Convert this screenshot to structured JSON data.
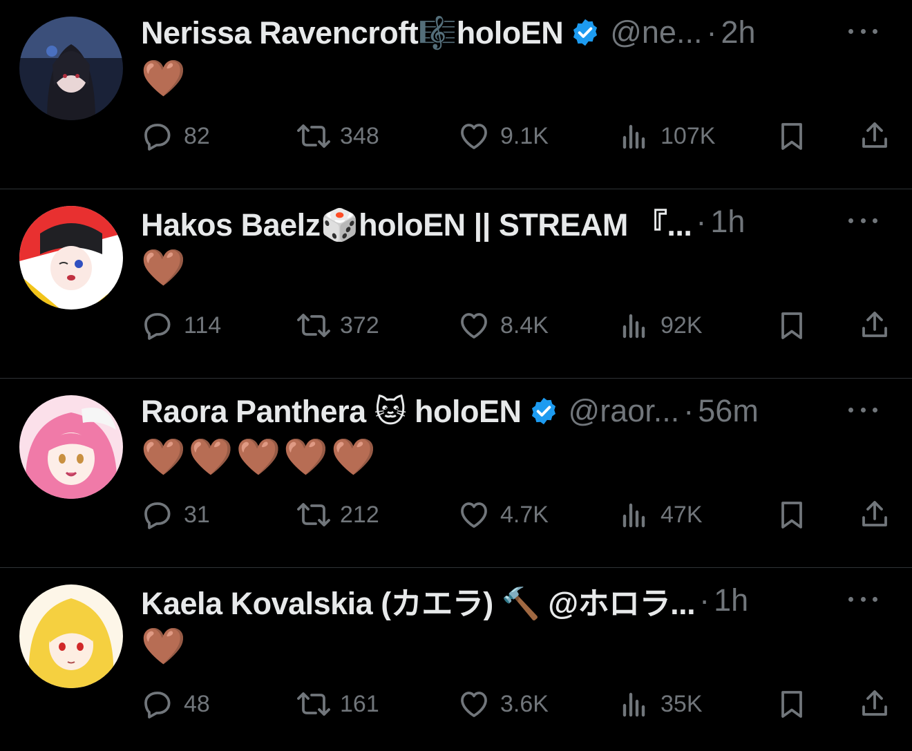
{
  "tweets": [
    {
      "name": "Nerissa Ravencroft🎼holoEN",
      "verified": true,
      "handle": "@ne...",
      "separator": "·",
      "time": "2h",
      "body": "🤎",
      "replies": "82",
      "retweets": "348",
      "likes": "9.1K",
      "views": "107K",
      "avatar_color": "#2a3a5e"
    },
    {
      "name": "Hakos Baelz🎲holoEN || STREAM 『...",
      "verified": false,
      "handle": "",
      "separator": "·",
      "time": "1h",
      "body": "🤎",
      "replies": "114",
      "retweets": "372",
      "likes": "8.4K",
      "views": "92K",
      "avatar_color": "#d42a2a"
    },
    {
      "name": "Raora Panthera 🐱 holoEN",
      "verified": true,
      "handle": "@raor...",
      "separator": "·",
      "time": "56m",
      "body": "🤎🤎🤎🤎🤎",
      "replies": "31",
      "retweets": "212",
      "likes": "4.7K",
      "views": "47K",
      "avatar_color": "#f07aa8"
    },
    {
      "name": "Kaela Kovalskia (カエラ) 🔨 @ホロラ...",
      "verified": false,
      "handle": "",
      "separator": "·",
      "time": "1h",
      "body": "🤎",
      "replies": "48",
      "retweets": "161",
      "likes": "3.6K",
      "views": "35K",
      "avatar_color": "#f5d040"
    }
  ],
  "icons": {
    "verified": "verified-badge-icon",
    "more": "more-options-icon",
    "reply": "reply-icon",
    "retweet": "retweet-icon",
    "like": "heart-icon",
    "views": "views-icon",
    "bookmark": "bookmark-icon",
    "share": "share-icon"
  },
  "colors": {
    "background": "#000000",
    "text": "#e7e9ea",
    "muted": "#71767b",
    "verified": "#1d9bf0",
    "divider": "#2f3336"
  }
}
